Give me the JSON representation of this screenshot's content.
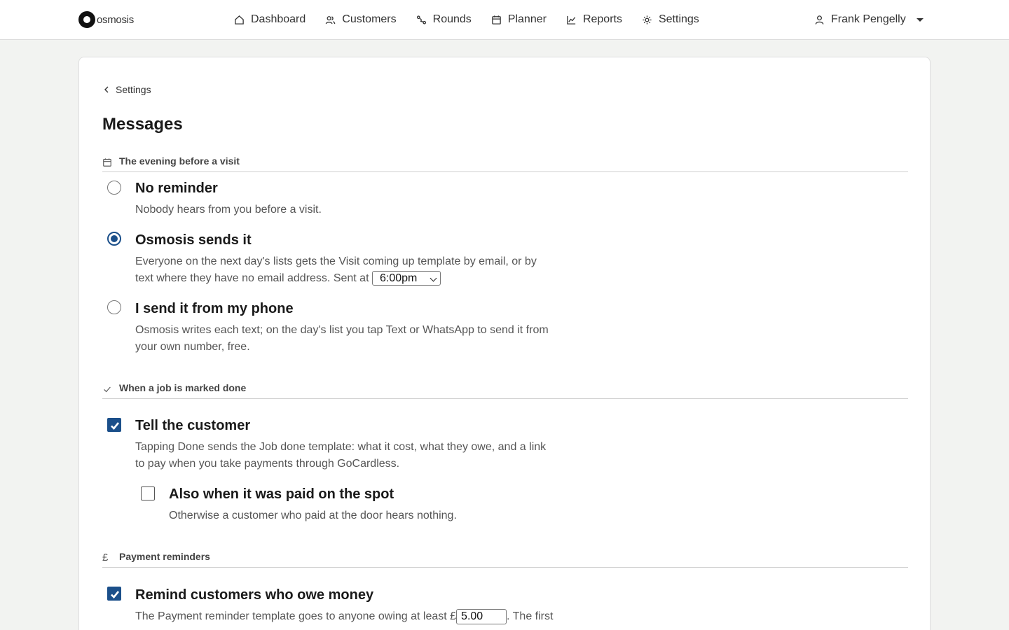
{
  "brand": {
    "name": "osmosis"
  },
  "nav": {
    "items": [
      {
        "label": "Dashboard",
        "icon": "home-icon"
      },
      {
        "label": "Customers",
        "icon": "users-icon"
      },
      {
        "label": "Rounds",
        "icon": "route-icon"
      },
      {
        "label": "Planner",
        "icon": "calendar-icon"
      },
      {
        "label": "Reports",
        "icon": "chart-icon"
      },
      {
        "label": "Settings",
        "icon": "gear-icon"
      }
    ],
    "user": "Frank Pengelly"
  },
  "page": {
    "back_label": "Settings",
    "title": "Messages"
  },
  "sections": {
    "evening": {
      "title": "The evening before a visit",
      "options": {
        "none": {
          "title": "No reminder",
          "desc": "Nobody hears from you before a visit.",
          "selected": false
        },
        "osmosis": {
          "title": "Osmosis sends it",
          "desc_before": "Everyone on the next day's lists gets the Visit coming up template by email, or by text where they have no email address. Sent at",
          "send_time": "6:00pm",
          "selected": true
        },
        "phone": {
          "title": "I send it from my phone",
          "desc": "Osmosis writes each text; on the day's list you tap Text or WhatsApp to send it from your own number, free.",
          "selected": false
        }
      }
    },
    "done": {
      "title": "When a job is marked done",
      "tell": {
        "title": "Tell the customer",
        "desc": "Tapping Done sends the Job done template: what it cost, what they owe, and a link to pay when you take payments through GoCardless.",
        "checked": true
      },
      "paid_spot": {
        "title": "Also when it was paid on the spot",
        "desc": "Otherwise a customer who paid at the door hears nothing.",
        "checked": false
      }
    },
    "payments": {
      "title": "Payment reminders",
      "currency_symbol": "£",
      "remind": {
        "title": "Remind customers who owe money",
        "desc_before": "The Payment reminder template goes to anyone owing at least £",
        "min_amount": "5.00",
        "desc_after": ". The first",
        "checked": true
      }
    }
  },
  "colors": {
    "accent": "#1b4f8a",
    "background": "#f2f3f1",
    "card": "#ffffff"
  }
}
